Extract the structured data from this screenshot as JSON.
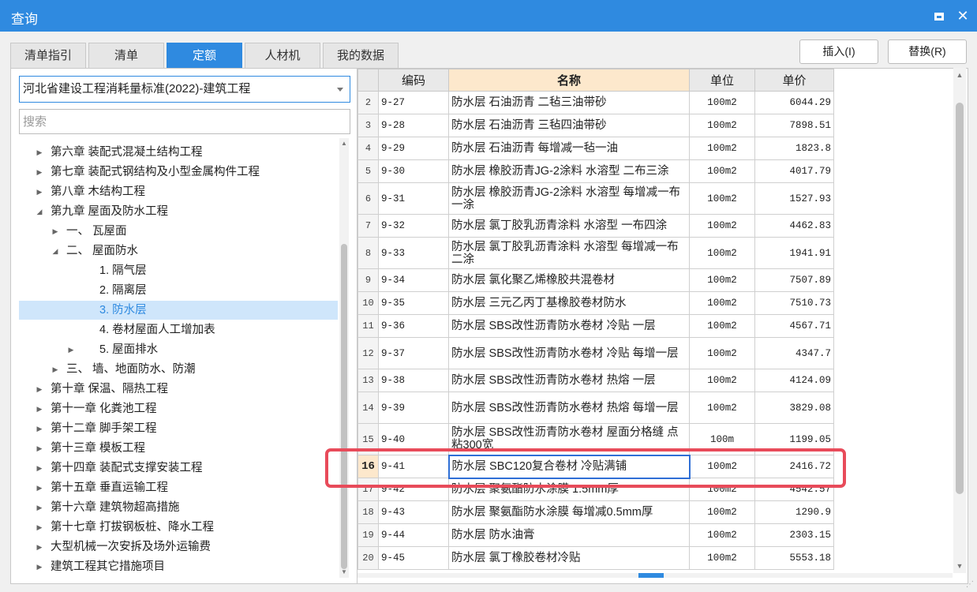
{
  "window": {
    "title": "查询"
  },
  "tabs": [
    {
      "label": "清单指引",
      "active": false
    },
    {
      "label": "清单",
      "active": false
    },
    {
      "label": "定额",
      "active": true
    },
    {
      "label": "人材机",
      "active": false
    },
    {
      "label": "我的数据",
      "active": false
    }
  ],
  "actions": {
    "insert_label": "插入(I)",
    "replace_label": "替换(R)"
  },
  "left": {
    "standard_selected": "河北省建设工程消耗量标准(2022)-建筑工程",
    "search_placeholder": "搜索",
    "tree": [
      {
        "label": "第六章 装配式混凝土结构工程",
        "expander": "collapsed",
        "level": 0
      },
      {
        "label": "第七章 装配式钢结构及小型金属构件工程",
        "expander": "collapsed",
        "level": 0
      },
      {
        "label": "第八章 木结构工程",
        "expander": "collapsed",
        "level": 0
      },
      {
        "label": "第九章 屋面及防水工程",
        "expander": "expanded",
        "level": 0
      },
      {
        "label": "一、 瓦屋面",
        "expander": "collapsed",
        "level": 1
      },
      {
        "label": "二、 屋面防水",
        "expander": "expanded",
        "level": 1
      },
      {
        "label": "1. 隔气层",
        "expander": "none",
        "level": 2
      },
      {
        "label": "2. 隔离层",
        "expander": "none",
        "level": 2
      },
      {
        "label": "3. 防水层",
        "expander": "none",
        "level": 2,
        "selected": true
      },
      {
        "label": "4. 卷材屋面人工增加表",
        "expander": "none",
        "level": 2
      },
      {
        "label": "5. 屋面排水",
        "expander": "collapsed",
        "level": 2
      },
      {
        "label": "三、 墙、地面防水、防潮",
        "expander": "collapsed",
        "level": 1
      },
      {
        "label": "第十章 保温、隔热工程",
        "expander": "collapsed",
        "level": 0
      },
      {
        "label": "第十一章 化粪池工程",
        "expander": "collapsed",
        "level": 0
      },
      {
        "label": "第十二章 脚手架工程",
        "expander": "collapsed",
        "level": 0
      },
      {
        "label": "第十三章 模板工程",
        "expander": "collapsed",
        "level": 0
      },
      {
        "label": "第十四章 装配式支撑安装工程",
        "expander": "collapsed",
        "level": 0
      },
      {
        "label": "第十五章 垂直运输工程",
        "expander": "collapsed",
        "level": 0
      },
      {
        "label": "第十六章 建筑物超高措施",
        "expander": "collapsed",
        "level": 0
      },
      {
        "label": "第十七章 打拔钢板桩、降水工程",
        "expander": "collapsed",
        "level": 0
      },
      {
        "label": "大型机械一次安拆及场外运输费",
        "expander": "collapsed",
        "level": 0
      },
      {
        "label": "建筑工程其它措施项目",
        "expander": "collapsed",
        "level": 0
      }
    ]
  },
  "grid": {
    "headers": {
      "code": "编码",
      "name": "名称",
      "unit": "单位",
      "price": "单价"
    },
    "rows": [
      {
        "no": "2",
        "code": "9-27",
        "name": "防水层 石油沥青 二毡三油带砂",
        "unit": "100m2",
        "price": "6044.29"
      },
      {
        "no": "3",
        "code": "9-28",
        "name": "防水层 石油沥青 三毡四油带砂",
        "unit": "100m2",
        "price": "7898.51"
      },
      {
        "no": "4",
        "code": "9-29",
        "name": "防水层 石油沥青 每增减一毡一油",
        "unit": "100m2",
        "price": "1823.8"
      },
      {
        "no": "5",
        "code": "9-30",
        "name": "防水层 橡胶沥青JG-2涂料 水溶型 二布三涂",
        "unit": "100m2",
        "price": "4017.79"
      },
      {
        "no": "6",
        "code": "9-31",
        "name": "防水层 橡胶沥青JG-2涂料 水溶型 每增减一布一涂",
        "unit": "100m2",
        "price": "1527.93"
      },
      {
        "no": "7",
        "code": "9-32",
        "name": "防水层 氯丁胶乳沥青涂料 水溶型 一布四涂",
        "unit": "100m2",
        "price": "4462.83"
      },
      {
        "no": "8",
        "code": "9-33",
        "name": "防水层 氯丁胶乳沥青涂料 水溶型 每增减一布二涂",
        "unit": "100m2",
        "price": "1941.91"
      },
      {
        "no": "9",
        "code": "9-34",
        "name": "防水层 氯化聚乙烯橡胶共混卷材",
        "unit": "100m2",
        "price": "7507.89"
      },
      {
        "no": "10",
        "code": "9-35",
        "name": "防水层 三元乙丙丁基橡胶卷材防水",
        "unit": "100m2",
        "price": "7510.73"
      },
      {
        "no": "11",
        "code": "9-36",
        "name": "防水层 SBS改性沥青防水卷材 冷贴 一层",
        "unit": "100m2",
        "price": "4567.71"
      },
      {
        "no": "12",
        "code": "9-37",
        "name": "防水层 SBS改性沥青防水卷材 冷贴 每增一层",
        "unit": "100m2",
        "price": "4347.7"
      },
      {
        "no": "13",
        "code": "9-38",
        "name": "防水层 SBS改性沥青防水卷材 热熔 一层",
        "unit": "100m2",
        "price": "4124.09"
      },
      {
        "no": "14",
        "code": "9-39",
        "name": "防水层 SBS改性沥青防水卷材 热熔 每增一层",
        "unit": "100m2",
        "price": "3829.08"
      },
      {
        "no": "15",
        "code": "9-40",
        "name": "防水层 SBS改性沥青防水卷材 屋面分格缝 点粘300宽",
        "unit": "100m",
        "price": "1199.05"
      },
      {
        "no": "16",
        "code": "9-41",
        "name": "防水层 SBC120复合卷材 冷贴满铺",
        "unit": "100m2",
        "price": "2416.72",
        "current": true
      },
      {
        "no": "17",
        "code": "9-42",
        "name": "防水层 聚氨酯防水涂膜 1.5mm厚",
        "unit": "100m2",
        "price": "4542.57"
      },
      {
        "no": "18",
        "code": "9-43",
        "name": "防水层 聚氨酯防水涂膜 每增减0.5mm厚",
        "unit": "100m2",
        "price": "1290.9"
      },
      {
        "no": "19",
        "code": "9-44",
        "name": "防水层 防水油膏",
        "unit": "100m2",
        "price": "2303.15"
      },
      {
        "no": "20",
        "code": "9-45",
        "name": "防水层 氯丁橡胶卷材冷贴",
        "unit": "100m2",
        "price": "5553.18"
      }
    ]
  },
  "icons": {
    "maximize": "maximize-icon",
    "close": "close-icon",
    "dropdown": "chevron-down-icon",
    "expand": "triangle-right-icon",
    "collapse": "triangle-down-icon"
  },
  "colors": {
    "accent": "#2f8ae0",
    "highlight": "#e84b5a",
    "header_name": "#fde8cc",
    "selected_tree": "#cfe6fb"
  }
}
